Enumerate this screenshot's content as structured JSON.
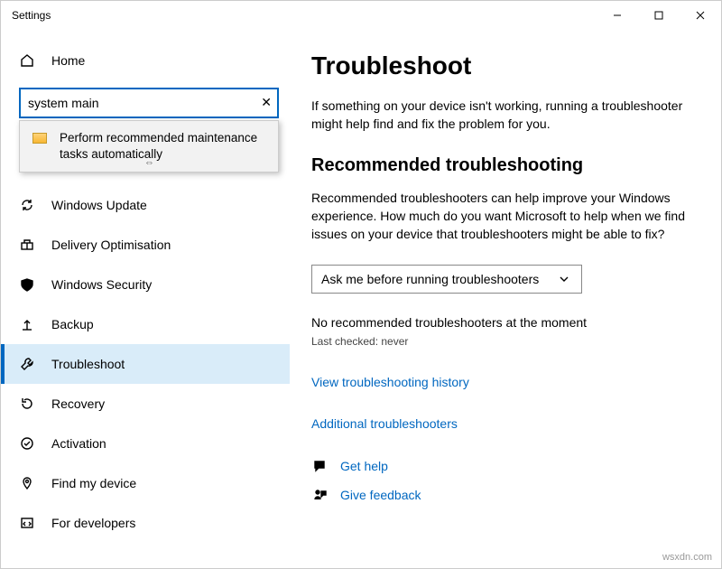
{
  "window": {
    "title": "Settings"
  },
  "sidebar": {
    "home_label": "Home",
    "search": {
      "value": "system main",
      "clear_glyph": "✕"
    },
    "suggestion": {
      "text": "Perform recommended maintenance tasks automatically",
      "resize_glyph": "⇔"
    },
    "items": [
      {
        "label": "Windows Update"
      },
      {
        "label": "Delivery Optimisation"
      },
      {
        "label": "Windows Security"
      },
      {
        "label": "Backup"
      },
      {
        "label": "Troubleshoot"
      },
      {
        "label": "Recovery"
      },
      {
        "label": "Activation"
      },
      {
        "label": "Find my device"
      },
      {
        "label": "For developers"
      }
    ]
  },
  "main": {
    "title": "Troubleshoot",
    "intro": "If something on your device isn't working, running a troubleshooter might help find and fix the problem for you.",
    "section_title": "Recommended troubleshooting",
    "section_body": "Recommended troubleshooters can help improve your Windows experience. How much do you want Microsoft to help when we find issues on your device that troubleshooters might be able to fix?",
    "select_value": "Ask me before running troubleshooters",
    "status": "No recommended troubleshooters at the moment",
    "last_checked": "Last checked: never",
    "history_link": "View troubleshooting history",
    "additional_link": "Additional troubleshooters",
    "get_help": "Get help",
    "give_feedback": "Give feedback"
  },
  "watermark": "wsxdn.com"
}
